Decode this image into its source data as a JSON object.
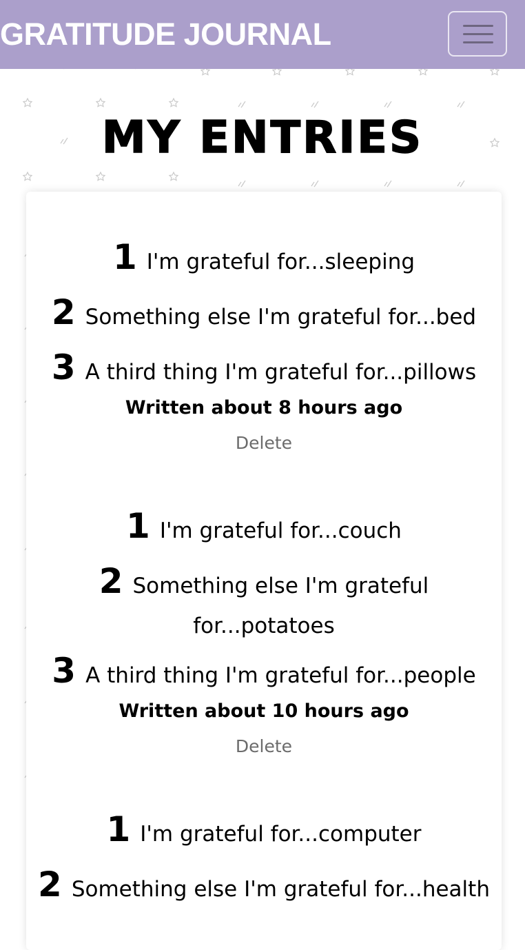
{
  "header": {
    "brand": "GRATITUDE JOURNAL",
    "menu_icon": "hamburger-menu-icon",
    "background_color": "#ab9fcb"
  },
  "page": {
    "title": "MY ENTRIES"
  },
  "entries": [
    {
      "items": [
        {
          "num": "1",
          "text": "I'm grateful for...sleeping"
        },
        {
          "num": "2",
          "text": "Something else I'm grateful for...bed"
        },
        {
          "num": "3",
          "text": "A third thing I'm grateful for...pillows"
        }
      ],
      "written": "Written about 8 hours ago",
      "delete_label": "Delete"
    },
    {
      "items": [
        {
          "num": "1",
          "text": "I'm grateful for...couch"
        },
        {
          "num": "2",
          "text": "Something else I'm grateful for...potatoes"
        },
        {
          "num": "3",
          "text": "A third thing I'm grateful for...people"
        }
      ],
      "written": "Written about 10 hours ago",
      "delete_label": "Delete"
    },
    {
      "items": [
        {
          "num": "1",
          "text": "I'm grateful for...computer"
        },
        {
          "num": "2",
          "text": "Something else I'm grateful for...health"
        }
      ]
    }
  ]
}
